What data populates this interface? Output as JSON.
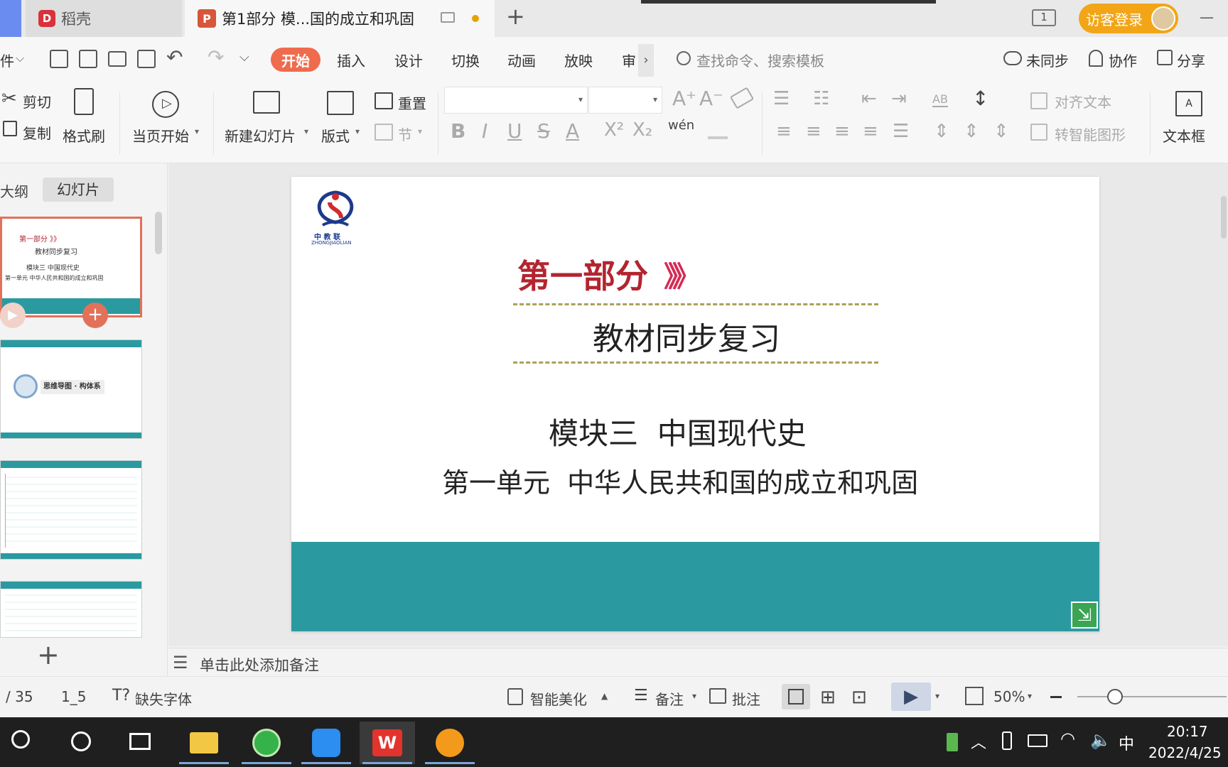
{
  "titlebar": {
    "tab1_label": "稻壳",
    "tab2_label": "第1部分  模...国的成立和巩固",
    "new_tab": "+",
    "page_badge": "1",
    "login_label": "访客登录",
    "minimize": "—"
  },
  "menubar": {
    "file_partial": "件",
    "tabs": [
      "开始",
      "插入",
      "设计",
      "切换",
      "动画",
      "放映",
      "审"
    ],
    "more": "›",
    "search_placeholder": "查找命令、搜索模板",
    "sync": "未同步",
    "collab": "协作",
    "share": "分享"
  },
  "ribbon": {
    "cut": "剪切",
    "copy": "复制",
    "format_painter": "格式刷",
    "play_from_current": "当页开始",
    "new_slide": "新建幻灯片",
    "layout": "版式",
    "section": "节",
    "reset": "重置",
    "pinyin": "wén",
    "align_text": "对齐文本",
    "smart_graphic": "转智能图形",
    "text_box": "文本框"
  },
  "leftpanel": {
    "tab_outline": "大纲",
    "tab_slides": "幻灯片",
    "thumb1": {
      "line1": "第一部分 》》",
      "line2": "教材同步复习",
      "line3": "模块三  中国现代史",
      "line4": "第一单元  中华人民共和国的成立和巩固"
    },
    "thumb2_label": "思维导图 · 构体系",
    "add_slide": "+"
  },
  "slide": {
    "logo_cn": "中 教 联",
    "logo_en": "ZHONGJIAOLIAN",
    "part": "第一部分",
    "chevrons": "》》》",
    "subtitle": "教材同步复习",
    "module": "模块三  中国现代史",
    "unit": "第一单元  中华人民共和国的成立和巩固"
  },
  "notes": {
    "placeholder": "单击此处添加备注"
  },
  "status": {
    "page": "/ 35",
    "layout_id": "1_5",
    "missing_font": "缺失字体",
    "beautify": "智能美化",
    "notes": "备注",
    "comment": "批注",
    "zoom": "50%"
  },
  "taskbar": {
    "time": "20:17",
    "date": "2022/4/25",
    "ime": "中"
  },
  "colors": {
    "accent_orange": "#ef6b4d",
    "teal": "#2b9aa0",
    "title_red": "#b3242f",
    "login_yellow": "#f2a516"
  }
}
